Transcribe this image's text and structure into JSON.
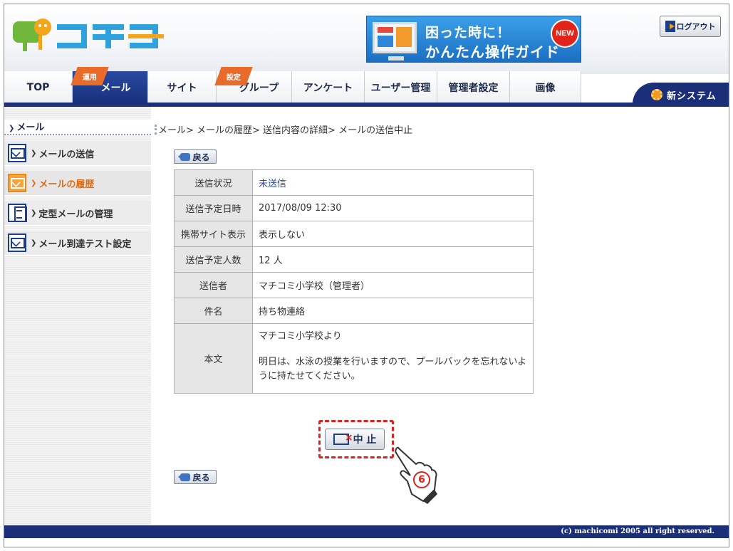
{
  "header": {
    "logo_text": "マチコミ",
    "banner": {
      "line1": "困った時に！",
      "line2": "かんたん操作ガイド",
      "badge": "NEW"
    },
    "logout_label": "ログアウト"
  },
  "nav": {
    "tabs": [
      {
        "label": "TOP"
      },
      {
        "label": "メール",
        "ribbon": "運用"
      },
      {
        "label": "サイト"
      },
      {
        "label": "グループ",
        "ribbon": "設定"
      },
      {
        "label": "アンケート"
      },
      {
        "label": "ユーザー管理"
      },
      {
        "label": "管理者設定"
      },
      {
        "label": "画像"
      }
    ],
    "new_system_label": "新システム"
  },
  "sidebar": {
    "heading": "メール",
    "items": [
      {
        "label": "メールの送信",
        "icon": "mail-send-icon"
      },
      {
        "label": "メールの履歴",
        "icon": "mail-history-icon",
        "active": true
      },
      {
        "label": "定型メールの管理",
        "icon": "template-icon"
      },
      {
        "label": " メール到達テスト設定",
        "icon": "mail-test-icon"
      }
    ]
  },
  "breadcrumb": "メール> メールの履歴> 送信内容の詳細> メールの送信中止",
  "back_label": "戻る",
  "details": [
    {
      "label": "送信状況",
      "value": "未送信"
    },
    {
      "label": "送信予定日時",
      "value": "2017/08/09 12:30"
    },
    {
      "label": "携帯サイト表示",
      "value": "表示しない"
    },
    {
      "label": "送信予定人数",
      "value": "12 人"
    },
    {
      "label": "送信者",
      "value": "マチコミ小学校（管理者）"
    },
    {
      "label": "件名",
      "value": "持ち物連絡"
    }
  ],
  "body": {
    "label": "本文",
    "line1": "マチコミ小学校より",
    "line2": "明日は、水泳の授業を行いますので、プールバックを忘れないように持たせてください。"
  },
  "stop_label": "中 止",
  "step_number": "6",
  "footer": "(c) machicomi 2005 all right reserved.",
  "colors": {
    "navy": "#1a2f78",
    "accent_orange": "#e86b2a",
    "highlight_red": "#d9231c"
  }
}
